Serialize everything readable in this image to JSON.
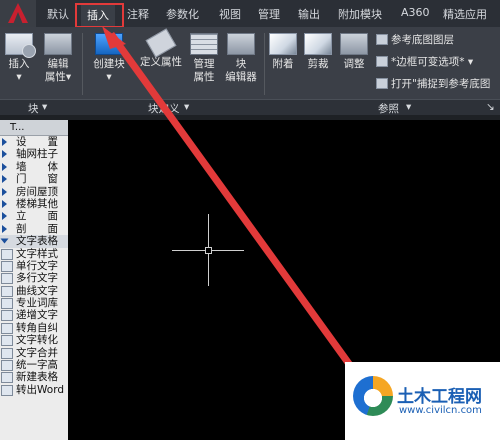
{
  "ribbon_tabs": [
    "默认",
    "插入",
    "注释",
    "参数化",
    "视图",
    "管理",
    "输出",
    "附加模块",
    "A360",
    "精选应用"
  ],
  "active_tab": "插入",
  "ribbon": {
    "insert": "插入",
    "edit_attr_1": "编辑",
    "edit_attr_2": "属性",
    "create_block": "创建块",
    "define_attr": "定义属性",
    "manage_attr_1": "管理",
    "manage_attr_2": "属性",
    "block_editor_1": "块",
    "block_editor_2": "编辑器",
    "attach": "附着",
    "clip": "剪裁",
    "adjust": "调整",
    "ref_underlay_layers": "参考底图图层",
    "frame_variable": "*边框可变选项*",
    "open_snap": "打开\"捕捉到参考底图",
    "panel_block": "块",
    "panel_block_def": "块定义",
    "panel_reference": "参照"
  },
  "palette": {
    "header": "T...",
    "items": [
      "设　　置",
      "轴网柱子",
      "墙　　体",
      "门　　窗",
      "房间屋顶",
      "楼梯其他",
      "立　　面",
      "剖　　面",
      "文字表格",
      "文字样式",
      "单行文字",
      "多行文字",
      "曲线文字",
      "专业词库",
      "递增文字",
      "转角自纠",
      "文字转化",
      "文字合并",
      "统一字高",
      "新建表格",
      "转出Word"
    ]
  },
  "watermark": {
    "title": "土木工程网",
    "url": "www.civilcn.com"
  },
  "colors": {
    "highlight_box": "#e23a3a",
    "arrow": "#e23a3a",
    "canvas": "#000000",
    "ribbon": "#3b3f47"
  }
}
